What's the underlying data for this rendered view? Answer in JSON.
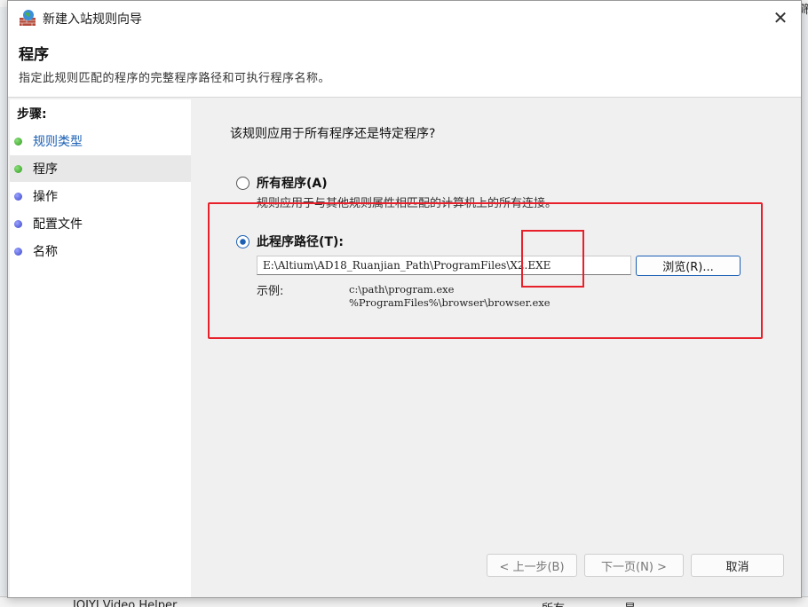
{
  "background": {
    "row_text": "IQIYI Video Helper",
    "col2": "所有",
    "col3": "是",
    "right_edge_text": "筛"
  },
  "dialog": {
    "title": "新建入站规则向导",
    "close_glyph": "✕",
    "header": {
      "title": "程序",
      "description": "指定此规则匹配的程序的完整程序路径和可执行程序名称。"
    },
    "steps_label": "步骤:",
    "steps": [
      {
        "label": "规则类型",
        "state": "done"
      },
      {
        "label": "程序",
        "state": "done"
      },
      {
        "label": "操作",
        "state": "todo"
      },
      {
        "label": "配置文件",
        "state": "todo"
      },
      {
        "label": "名称",
        "state": "todo"
      }
    ],
    "question": "该规则应用于所有程序还是特定程序?",
    "all_programs": {
      "label": "所有程序(A)",
      "description": "规则应用于与其他规则属性相匹配的计算机上的所有连接。"
    },
    "this_program": {
      "label": "此程序路径(T):",
      "path_value": "E:\\Altium\\AD18_Ruanjian_Path\\ProgramFiles\\X2.EXE",
      "browse_label": "浏览(R)...",
      "example_label": "示例:",
      "example_lines": [
        "c:\\path\\program.exe",
        "%ProgramFiles%\\browser\\browser.exe"
      ]
    },
    "buttons": {
      "back": "< 上一步(B)",
      "next": "下一页(N) >",
      "cancel": "取消"
    }
  },
  "colors": {
    "accent": "#1a5fb4",
    "annotation": "#e8202a",
    "step_done": "#2f9a1f",
    "step_todo": "#3a44c8"
  }
}
